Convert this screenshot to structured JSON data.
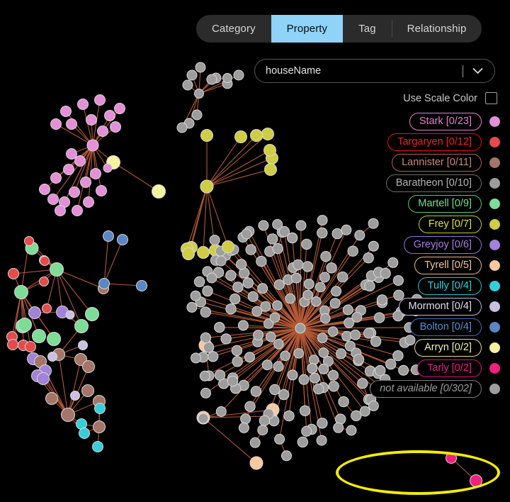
{
  "tabs": {
    "items": [
      {
        "label": "Category",
        "active": false
      },
      {
        "label": "Property",
        "active": true
      },
      {
        "label": "Tag",
        "active": false
      },
      {
        "label": "Relationship",
        "active": false
      }
    ]
  },
  "property_select": {
    "value": "houseName",
    "chevron_icon": "chevron-down-icon"
  },
  "scale_color": {
    "label": "Use Scale Color",
    "checked": false
  },
  "legend": {
    "items": [
      {
        "label": "Stark [0/23]",
        "text_color": "#e87fd0",
        "border_color": "#e87fd0",
        "dot_color": "#e48fd8",
        "italic": false
      },
      {
        "label": "Targaryen [0/12]",
        "text_color": "#f22121",
        "border_color": "#f00c0c",
        "dot_color": "#e44b4b",
        "italic": false
      },
      {
        "label": "Lannister [0/11]",
        "text_color": "#c98a7e",
        "border_color": "#a5685c",
        "dot_color": "#a5756a",
        "italic": false
      },
      {
        "label": "Baratheon [0/10]",
        "text_color": "#b4b4b4",
        "border_color": "#6e6e6e",
        "dot_color": "#9d9d9d",
        "italic": false
      },
      {
        "label": "Martell [0/9]",
        "text_color": "#6fe08c",
        "border_color": "#54c96f",
        "dot_color": "#7ddc96",
        "italic": false
      },
      {
        "label": "Frey [0/7]",
        "text_color": "#e8e819",
        "border_color": "#c9c91c",
        "dot_color": "#cfce42",
        "italic": false
      },
      {
        "label": "Greyjoy [0/6]",
        "text_color": "#a87ee8",
        "border_color": "#9a6fe0",
        "dot_color": "#a382d9",
        "italic": false
      },
      {
        "label": "Tyrell [0/5]",
        "text_color": "#f5c79a",
        "border_color": "#e8b98c",
        "dot_color": "#f8c89e",
        "italic": false
      },
      {
        "label": "Tully [0/4]",
        "text_color": "#2ad5e0",
        "border_color": "#22c4d0",
        "dot_color": "#35cfdc",
        "italic": false
      },
      {
        "label": "Mormont [0/4]",
        "text_color": "#e2dcf2",
        "border_color": "#c4b8e0",
        "dot_color": "#c9c0e2",
        "italic": false
      },
      {
        "label": "Bolton [0/4]",
        "text_color": "#5e8fd0",
        "border_color": "#3f6fb8",
        "dot_color": "#5b87c4",
        "italic": false
      },
      {
        "label": "Arryn [0/2]",
        "text_color": "#f2f2a8",
        "border_color": "#e2e28c",
        "dot_color": "#f4f4a0",
        "italic": false
      },
      {
        "label": "Tarly [0/2]",
        "text_color": "#f01a8c",
        "border_color": "#e00f82",
        "dot_color": "#f0207f",
        "italic": false
      },
      {
        "label": "not available [0/302]",
        "text_color": "#9e9e9e",
        "border_color": "#7a7a7a",
        "dot_color": "#9d9d9d",
        "italic": true
      }
    ]
  },
  "annotation": {
    "shape": "ellipse",
    "color": "#f5ec00",
    "target_label": "not available [0/302]"
  },
  "graph": {
    "edge_color": "#c4623c",
    "node_stroke": "#d8d8d8",
    "clusters": [
      {
        "name": "Stark",
        "color": "#e48fd8",
        "node_count": 23
      },
      {
        "name": "Targaryen",
        "color": "#e44b4b",
        "node_count": 12
      },
      {
        "name": "Lannister",
        "color": "#a5756a",
        "node_count": 11
      },
      {
        "name": "Baratheon",
        "color": "#9d9d9d",
        "node_count": 10
      },
      {
        "name": "Martell",
        "color": "#7ddc96",
        "node_count": 9
      },
      {
        "name": "Frey",
        "color": "#cfce42",
        "node_count": 7
      },
      {
        "name": "Greyjoy",
        "color": "#a382d9",
        "node_count": 6
      },
      {
        "name": "Tyrell",
        "color": "#f8c89e",
        "node_count": 5
      },
      {
        "name": "Tully",
        "color": "#35cfdc",
        "node_count": 4
      },
      {
        "name": "Mormont",
        "color": "#c9c0e2",
        "node_count": 4
      },
      {
        "name": "Bolton",
        "color": "#5b87c4",
        "node_count": 4
      },
      {
        "name": "Arryn",
        "color": "#f4f4a0",
        "node_count": 2
      },
      {
        "name": "Tarly",
        "color": "#f0207f",
        "node_count": 2
      },
      {
        "name": "not available",
        "color": "#9d9d9d",
        "node_count": 302
      }
    ]
  }
}
